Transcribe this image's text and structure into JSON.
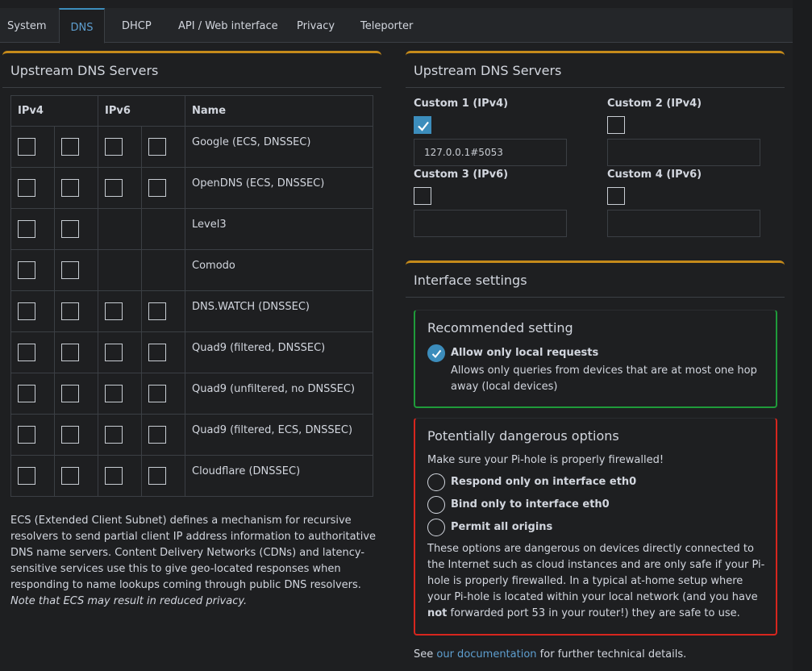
{
  "tabs": [
    "System",
    "DNS",
    "DHCP",
    "API / Web interface",
    "Privacy",
    "Teleporter"
  ],
  "active_tab": "DNS",
  "left_box": {
    "title": "Upstream DNS Servers",
    "headers": {
      "ipv4": "IPv4",
      "ipv6": "IPv6",
      "name": "Name"
    },
    "servers": [
      {
        "name": "Google (ECS, DNSSEC)",
        "has_ipv6": true
      },
      {
        "name": "OpenDNS (ECS, DNSSEC)",
        "has_ipv6": true
      },
      {
        "name": "Level3",
        "has_ipv6": false
      },
      {
        "name": "Comodo",
        "has_ipv6": false
      },
      {
        "name": "DNS.WATCH (DNSSEC)",
        "has_ipv6": true
      },
      {
        "name": "Quad9 (filtered, DNSSEC)",
        "has_ipv6": true
      },
      {
        "name": "Quad9 (unfiltered, no DNSSEC)",
        "has_ipv6": true
      },
      {
        "name": "Quad9 (filtered, ECS, DNSSEC)",
        "has_ipv6": true
      },
      {
        "name": "Cloudflare (DNSSEC)",
        "has_ipv6": true
      }
    ],
    "ecs_text": "ECS (Extended Client Subnet) defines a mechanism for recursive resolvers to send partial client IP address information to authoritative DNS name servers. Content Delivery Networks (CDNs) and latency-sensitive services use this to give geo-located responses when responding to name lookups coming through public DNS resolvers.",
    "ecs_note": "Note that ECS may result in reduced privacy."
  },
  "right_box": {
    "title": "Upstream DNS Servers",
    "custom1": {
      "label": "Custom 1 (IPv4)",
      "checked": true,
      "value": "127.0.0.1#5053"
    },
    "custom2": {
      "label": "Custom 2 (IPv4)",
      "checked": false,
      "value": ""
    },
    "custom3": {
      "label": "Custom 3 (IPv6)",
      "checked": false,
      "value": ""
    },
    "custom4": {
      "label": "Custom 4 (IPv6)",
      "checked": false,
      "value": ""
    }
  },
  "interface": {
    "title": "Interface settings",
    "recommended": {
      "title": "Recommended setting",
      "option": "Allow only local requests",
      "desc": "Allows only queries from devices that are at most one hop away (local devices)"
    },
    "dangerous": {
      "title": "Potentially dangerous options",
      "warning": "Make sure your Pi-hole is properly firewalled!",
      "options": [
        "Respond only on interface eth0",
        "Bind only to interface eth0",
        "Permit all origins"
      ],
      "text_before": "These options are dangerous on devices directly connected to the Internet such as cloud instances and are only safe if your Pi-hole is properly firewalled. In a typical at-home setup where your Pi-hole is located within your local network (and you have ",
      "text_bold": "not",
      "text_after": " forwarded port 53 in your router!) they are safe to use."
    },
    "footer_before": "See ",
    "footer_link": "our documentation",
    "footer_after": " for further technical details."
  },
  "colors": {
    "accent": "#3c8dbc",
    "box_border": "#c58a1a",
    "green": "#1f9b3a",
    "red": "#d7261e"
  }
}
